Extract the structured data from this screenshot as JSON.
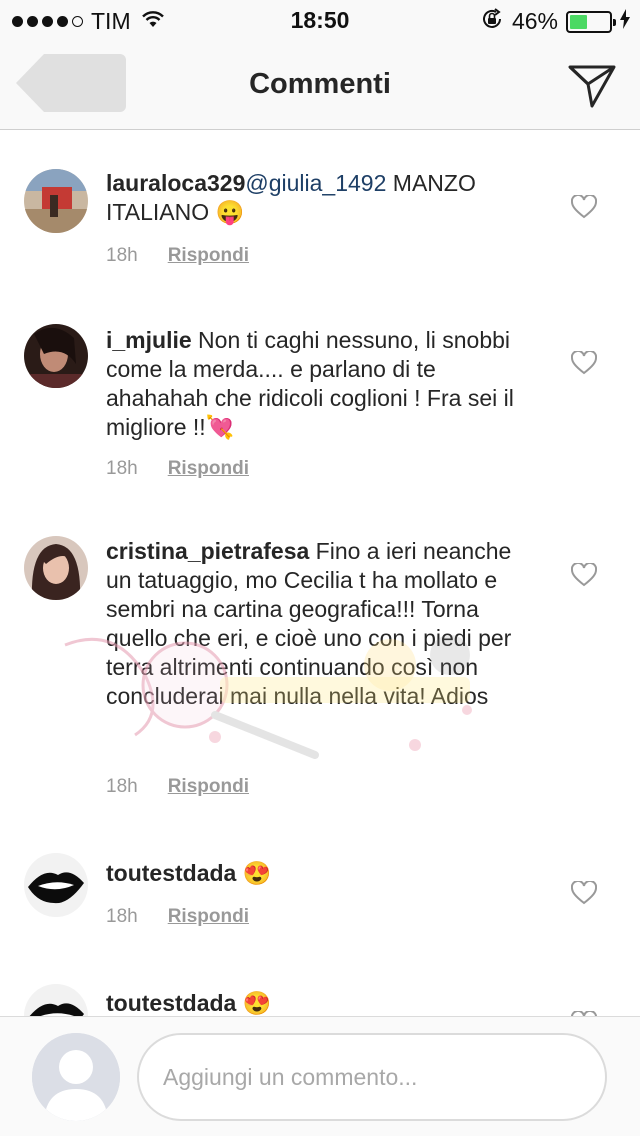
{
  "status_bar": {
    "carrier": "TIM",
    "time": "18:50",
    "battery_percent": "46%",
    "battery_level": 0.46,
    "signal_bars_filled": 4,
    "signal_bars_total": 5
  },
  "nav": {
    "title": "Commenti",
    "back_icon": "back-arrow-icon",
    "send_icon": "paper-plane-icon"
  },
  "comments": [
    {
      "username": "lauraloca329",
      "mention": "@giulia_1492",
      "text": " MANZO ITALIANO 😛",
      "time": "18h",
      "reply": "Rispondi"
    },
    {
      "username": "i_mjulie",
      "mention": "",
      "text": " Non ti caghi nessuno, li snobbi come la merda.... e parlano di te ahahahah che ridicoli coglioni ! Fra sei il migliore !!💘",
      "time": "18h",
      "reply": "Rispondi"
    },
    {
      "username": "cristina_pietrafesa",
      "mention": "",
      "text": " Fino a ieri neanche un tatuaggio, mo Cecilia t ha mollato e sembri na cartina geografica!!! Torna quello che eri, e cioè uno con i piedi per terra altrimenti continuando così non concluderai mai nulla nella vita! Adios",
      "time": "18h",
      "reply": "Rispondi"
    },
    {
      "username": "toutestdada",
      "mention": "",
      "text": " 😍",
      "time": "18h",
      "reply": "Rispondi"
    },
    {
      "username": "toutestdada",
      "mention": "",
      "text": " 😍",
      "time": "",
      "reply": ""
    }
  ],
  "input": {
    "placeholder": "Aggiungi un commento..."
  },
  "colors": {
    "accent_link": "#1e3f66",
    "meta_gray": "#999999",
    "battery_green": "#4cd964"
  }
}
